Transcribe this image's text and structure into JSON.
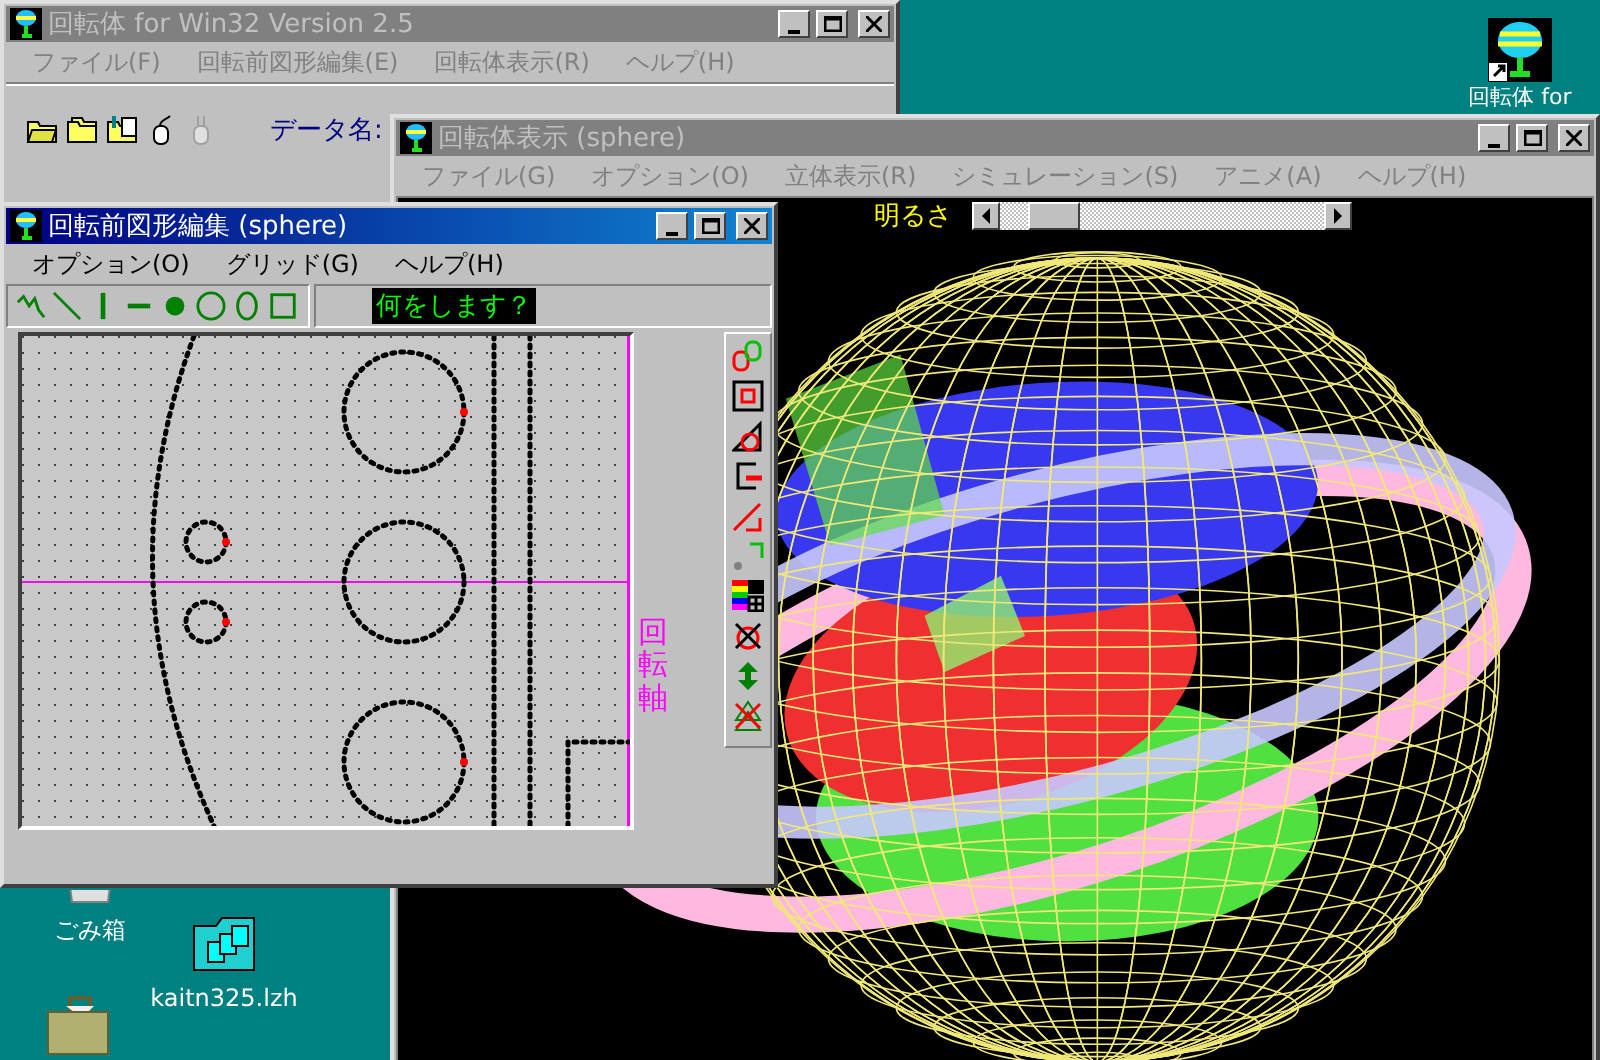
{
  "main_window": {
    "title": "回転体  for Win32 Version 2.5",
    "active": false,
    "menu": [
      "ファイル(F)",
      "回転前図形編集(E)",
      "回転体表示(R)",
      "ヘルプ(H)"
    ],
    "data_label": "データ名:"
  },
  "view_window": {
    "title": "回転体表示 (sphere)",
    "active": false,
    "menu": [
      "ファイル(G)",
      "オプション(O)",
      "立体表示(R)",
      "シミュレーション(S)",
      "アニメ(A)",
      "ヘルプ(H)"
    ],
    "brightness": {
      "label": "明るさ",
      "level": 0.1
    }
  },
  "edit_window": {
    "title": "回転前図形編集 (sphere)",
    "active": true,
    "menu": [
      "オプション(O)",
      "グリッド(G)",
      "ヘルプ(H)"
    ],
    "status": "何をします？",
    "axis_label": "回転軸"
  },
  "desktop_icons": [
    {
      "kind": "app",
      "label": "回転体 for"
    },
    {
      "kind": "trash",
      "label": "ごみ箱"
    },
    {
      "kind": "archive",
      "label": "kaitn325.lzh"
    },
    {
      "kind": "briefcase"
    }
  ]
}
